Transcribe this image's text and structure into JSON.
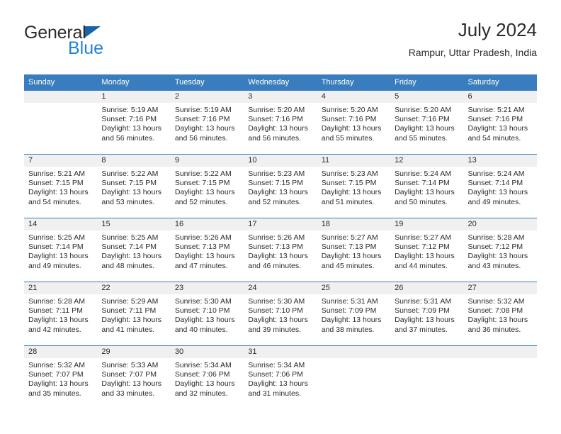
{
  "brand": {
    "name_top": "General",
    "name_bottom": "Blue",
    "triangle_icon": "triangle-icon",
    "accent_blue": "#1f82d8",
    "logo_triangle_color": "#1565a8"
  },
  "header": {
    "title": "July 2024",
    "subtitle": "Rampur, Uttar Pradesh, India"
  },
  "theme": {
    "header_bar_color": "#3a7dbe",
    "daynum_band_color": "#f0f0f0",
    "text_color": "#2b2b2b"
  },
  "weekday_headers": [
    "Sunday",
    "Monday",
    "Tuesday",
    "Wednesday",
    "Thursday",
    "Friday",
    "Saturday"
  ],
  "weeks": [
    [
      {
        "day": "",
        "empty": true,
        "sunrise": "",
        "sunset": "",
        "daylight_line1": "",
        "daylight_line2": ""
      },
      {
        "day": "1",
        "sunrise": "Sunrise: 5:19 AM",
        "sunset": "Sunset: 7:16 PM",
        "daylight_line1": "Daylight: 13 hours",
        "daylight_line2": "and 56 minutes."
      },
      {
        "day": "2",
        "sunrise": "Sunrise: 5:19 AM",
        "sunset": "Sunset: 7:16 PM",
        "daylight_line1": "Daylight: 13 hours",
        "daylight_line2": "and 56 minutes."
      },
      {
        "day": "3",
        "sunrise": "Sunrise: 5:20 AM",
        "sunset": "Sunset: 7:16 PM",
        "daylight_line1": "Daylight: 13 hours",
        "daylight_line2": "and 56 minutes."
      },
      {
        "day": "4",
        "sunrise": "Sunrise: 5:20 AM",
        "sunset": "Sunset: 7:16 PM",
        "daylight_line1": "Daylight: 13 hours",
        "daylight_line2": "and 55 minutes."
      },
      {
        "day": "5",
        "sunrise": "Sunrise: 5:20 AM",
        "sunset": "Sunset: 7:16 PM",
        "daylight_line1": "Daylight: 13 hours",
        "daylight_line2": "and 55 minutes."
      },
      {
        "day": "6",
        "sunrise": "Sunrise: 5:21 AM",
        "sunset": "Sunset: 7:16 PM",
        "daylight_line1": "Daylight: 13 hours",
        "daylight_line2": "and 54 minutes."
      }
    ],
    [
      {
        "day": "7",
        "sunrise": "Sunrise: 5:21 AM",
        "sunset": "Sunset: 7:15 PM",
        "daylight_line1": "Daylight: 13 hours",
        "daylight_line2": "and 54 minutes."
      },
      {
        "day": "8",
        "sunrise": "Sunrise: 5:22 AM",
        "sunset": "Sunset: 7:15 PM",
        "daylight_line1": "Daylight: 13 hours",
        "daylight_line2": "and 53 minutes."
      },
      {
        "day": "9",
        "sunrise": "Sunrise: 5:22 AM",
        "sunset": "Sunset: 7:15 PM",
        "daylight_line1": "Daylight: 13 hours",
        "daylight_line2": "and 52 minutes."
      },
      {
        "day": "10",
        "sunrise": "Sunrise: 5:23 AM",
        "sunset": "Sunset: 7:15 PM",
        "daylight_line1": "Daylight: 13 hours",
        "daylight_line2": "and 52 minutes."
      },
      {
        "day": "11",
        "sunrise": "Sunrise: 5:23 AM",
        "sunset": "Sunset: 7:15 PM",
        "daylight_line1": "Daylight: 13 hours",
        "daylight_line2": "and 51 minutes."
      },
      {
        "day": "12",
        "sunrise": "Sunrise: 5:24 AM",
        "sunset": "Sunset: 7:14 PM",
        "daylight_line1": "Daylight: 13 hours",
        "daylight_line2": "and 50 minutes."
      },
      {
        "day": "13",
        "sunrise": "Sunrise: 5:24 AM",
        "sunset": "Sunset: 7:14 PM",
        "daylight_line1": "Daylight: 13 hours",
        "daylight_line2": "and 49 minutes."
      }
    ],
    [
      {
        "day": "14",
        "sunrise": "Sunrise: 5:25 AM",
        "sunset": "Sunset: 7:14 PM",
        "daylight_line1": "Daylight: 13 hours",
        "daylight_line2": "and 49 minutes."
      },
      {
        "day": "15",
        "sunrise": "Sunrise: 5:25 AM",
        "sunset": "Sunset: 7:14 PM",
        "daylight_line1": "Daylight: 13 hours",
        "daylight_line2": "and 48 minutes."
      },
      {
        "day": "16",
        "sunrise": "Sunrise: 5:26 AM",
        "sunset": "Sunset: 7:13 PM",
        "daylight_line1": "Daylight: 13 hours",
        "daylight_line2": "and 47 minutes."
      },
      {
        "day": "17",
        "sunrise": "Sunrise: 5:26 AM",
        "sunset": "Sunset: 7:13 PM",
        "daylight_line1": "Daylight: 13 hours",
        "daylight_line2": "and 46 minutes."
      },
      {
        "day": "18",
        "sunrise": "Sunrise: 5:27 AM",
        "sunset": "Sunset: 7:13 PM",
        "daylight_line1": "Daylight: 13 hours",
        "daylight_line2": "and 45 minutes."
      },
      {
        "day": "19",
        "sunrise": "Sunrise: 5:27 AM",
        "sunset": "Sunset: 7:12 PM",
        "daylight_line1": "Daylight: 13 hours",
        "daylight_line2": "and 44 minutes."
      },
      {
        "day": "20",
        "sunrise": "Sunrise: 5:28 AM",
        "sunset": "Sunset: 7:12 PM",
        "daylight_line1": "Daylight: 13 hours",
        "daylight_line2": "and 43 minutes."
      }
    ],
    [
      {
        "day": "21",
        "sunrise": "Sunrise: 5:28 AM",
        "sunset": "Sunset: 7:11 PM",
        "daylight_line1": "Daylight: 13 hours",
        "daylight_line2": "and 42 minutes."
      },
      {
        "day": "22",
        "sunrise": "Sunrise: 5:29 AM",
        "sunset": "Sunset: 7:11 PM",
        "daylight_line1": "Daylight: 13 hours",
        "daylight_line2": "and 41 minutes."
      },
      {
        "day": "23",
        "sunrise": "Sunrise: 5:30 AM",
        "sunset": "Sunset: 7:10 PM",
        "daylight_line1": "Daylight: 13 hours",
        "daylight_line2": "and 40 minutes."
      },
      {
        "day": "24",
        "sunrise": "Sunrise: 5:30 AM",
        "sunset": "Sunset: 7:10 PM",
        "daylight_line1": "Daylight: 13 hours",
        "daylight_line2": "and 39 minutes."
      },
      {
        "day": "25",
        "sunrise": "Sunrise: 5:31 AM",
        "sunset": "Sunset: 7:09 PM",
        "daylight_line1": "Daylight: 13 hours",
        "daylight_line2": "and 38 minutes."
      },
      {
        "day": "26",
        "sunrise": "Sunrise: 5:31 AM",
        "sunset": "Sunset: 7:09 PM",
        "daylight_line1": "Daylight: 13 hours",
        "daylight_line2": "and 37 minutes."
      },
      {
        "day": "27",
        "sunrise": "Sunrise: 5:32 AM",
        "sunset": "Sunset: 7:08 PM",
        "daylight_line1": "Daylight: 13 hours",
        "daylight_line2": "and 36 minutes."
      }
    ],
    [
      {
        "day": "28",
        "sunrise": "Sunrise: 5:32 AM",
        "sunset": "Sunset: 7:07 PM",
        "daylight_line1": "Daylight: 13 hours",
        "daylight_line2": "and 35 minutes."
      },
      {
        "day": "29",
        "sunrise": "Sunrise: 5:33 AM",
        "sunset": "Sunset: 7:07 PM",
        "daylight_line1": "Daylight: 13 hours",
        "daylight_line2": "and 33 minutes."
      },
      {
        "day": "30",
        "sunrise": "Sunrise: 5:34 AM",
        "sunset": "Sunset: 7:06 PM",
        "daylight_line1": "Daylight: 13 hours",
        "daylight_line2": "and 32 minutes."
      },
      {
        "day": "31",
        "sunrise": "Sunrise: 5:34 AM",
        "sunset": "Sunset: 7:06 PM",
        "daylight_line1": "Daylight: 13 hours",
        "daylight_line2": "and 31 minutes."
      },
      {
        "day": "",
        "empty": true,
        "sunrise": "",
        "sunset": "",
        "daylight_line1": "",
        "daylight_line2": ""
      },
      {
        "day": "",
        "empty": true,
        "sunrise": "",
        "sunset": "",
        "daylight_line1": "",
        "daylight_line2": ""
      },
      {
        "day": "",
        "empty": true,
        "sunrise": "",
        "sunset": "",
        "daylight_line1": "",
        "daylight_line2": ""
      }
    ]
  ]
}
